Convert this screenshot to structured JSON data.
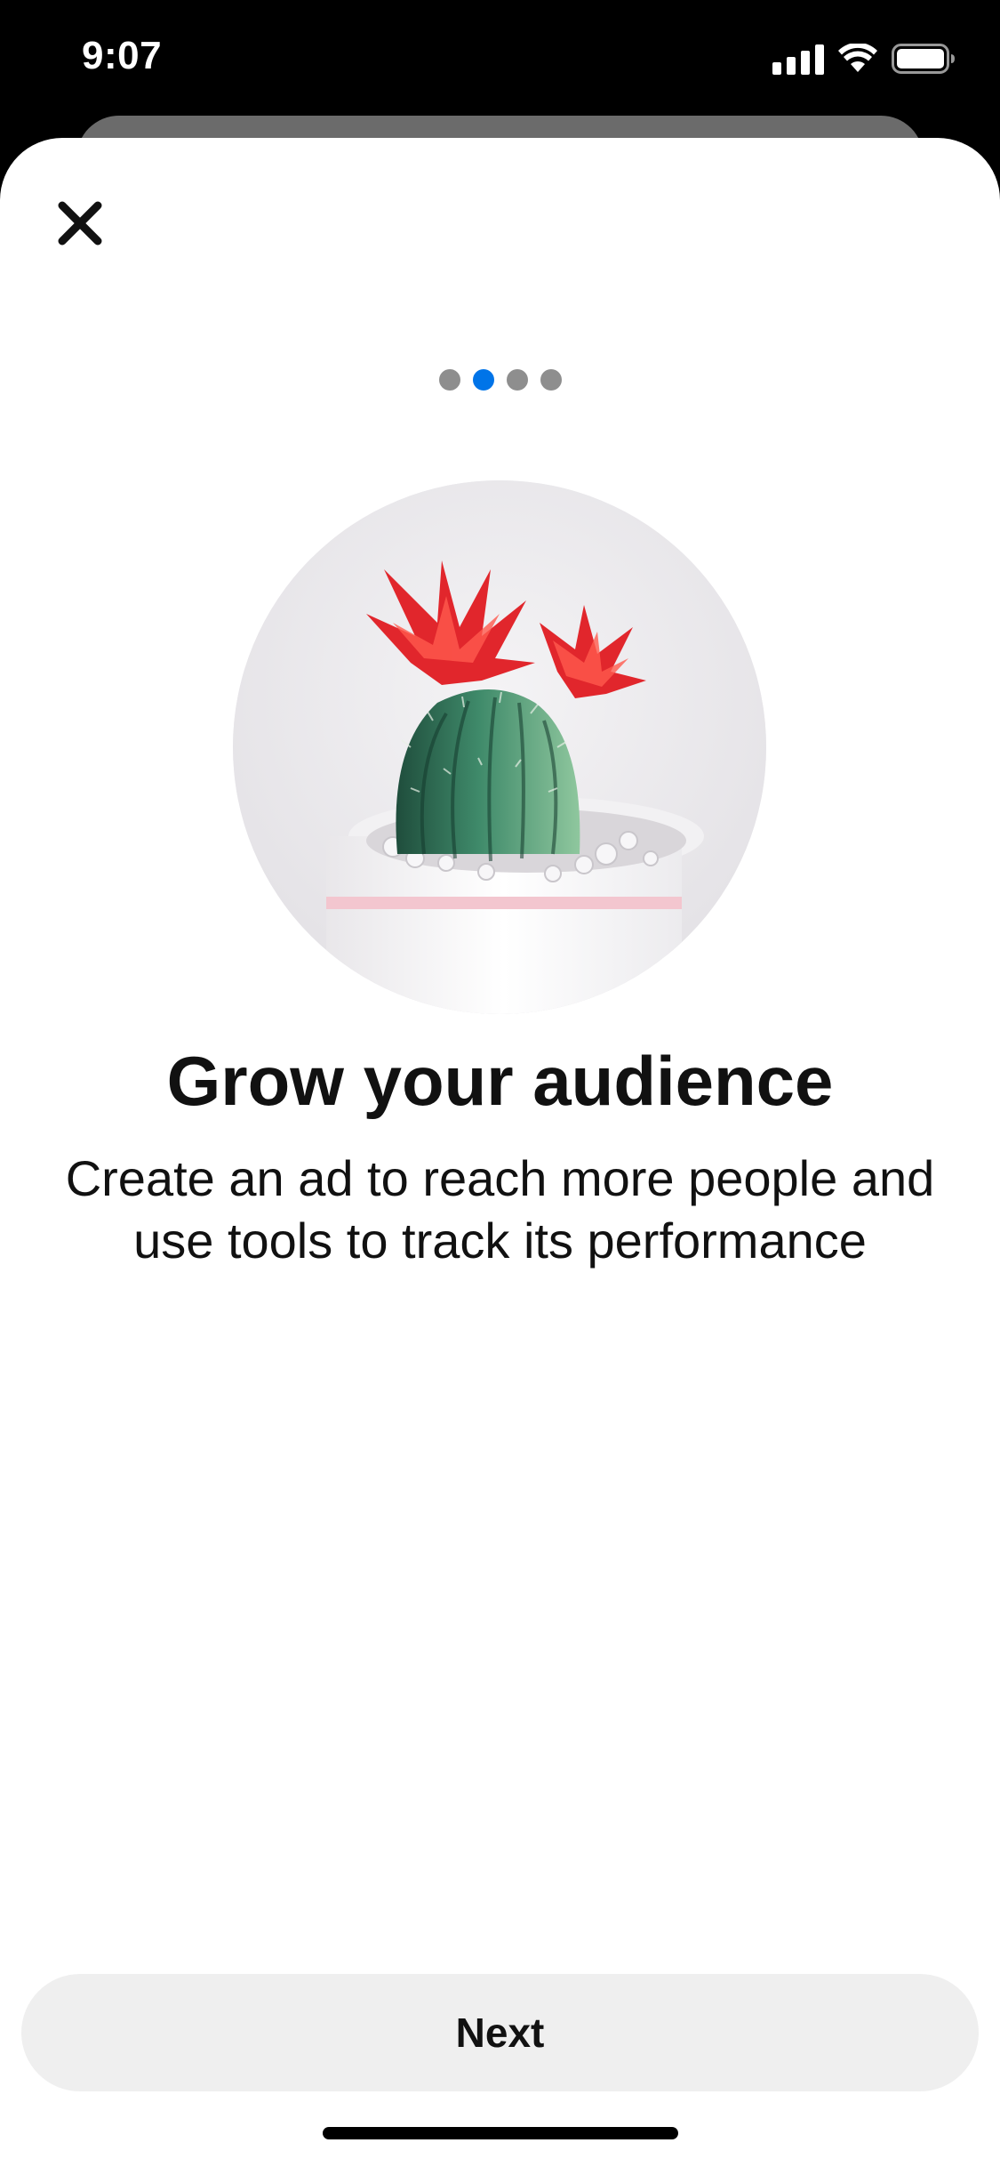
{
  "status_bar": {
    "time": "9:07",
    "icons": [
      "signal-icon",
      "wifi-icon",
      "battery-icon"
    ]
  },
  "header": {
    "close_icon": "close-icon"
  },
  "pager": {
    "total": 4,
    "active_index": 1,
    "active_color": "#0074e8",
    "inactive_color": "#8e8e8e"
  },
  "hero": {
    "image": "cactus-with-red-flowers-in-white-pot"
  },
  "content": {
    "title": "Grow your audience",
    "subtitle_line1": "Create an ad to reach more people and",
    "subtitle_line2": "use tools to track its performance"
  },
  "footer": {
    "next_label": "Next"
  }
}
